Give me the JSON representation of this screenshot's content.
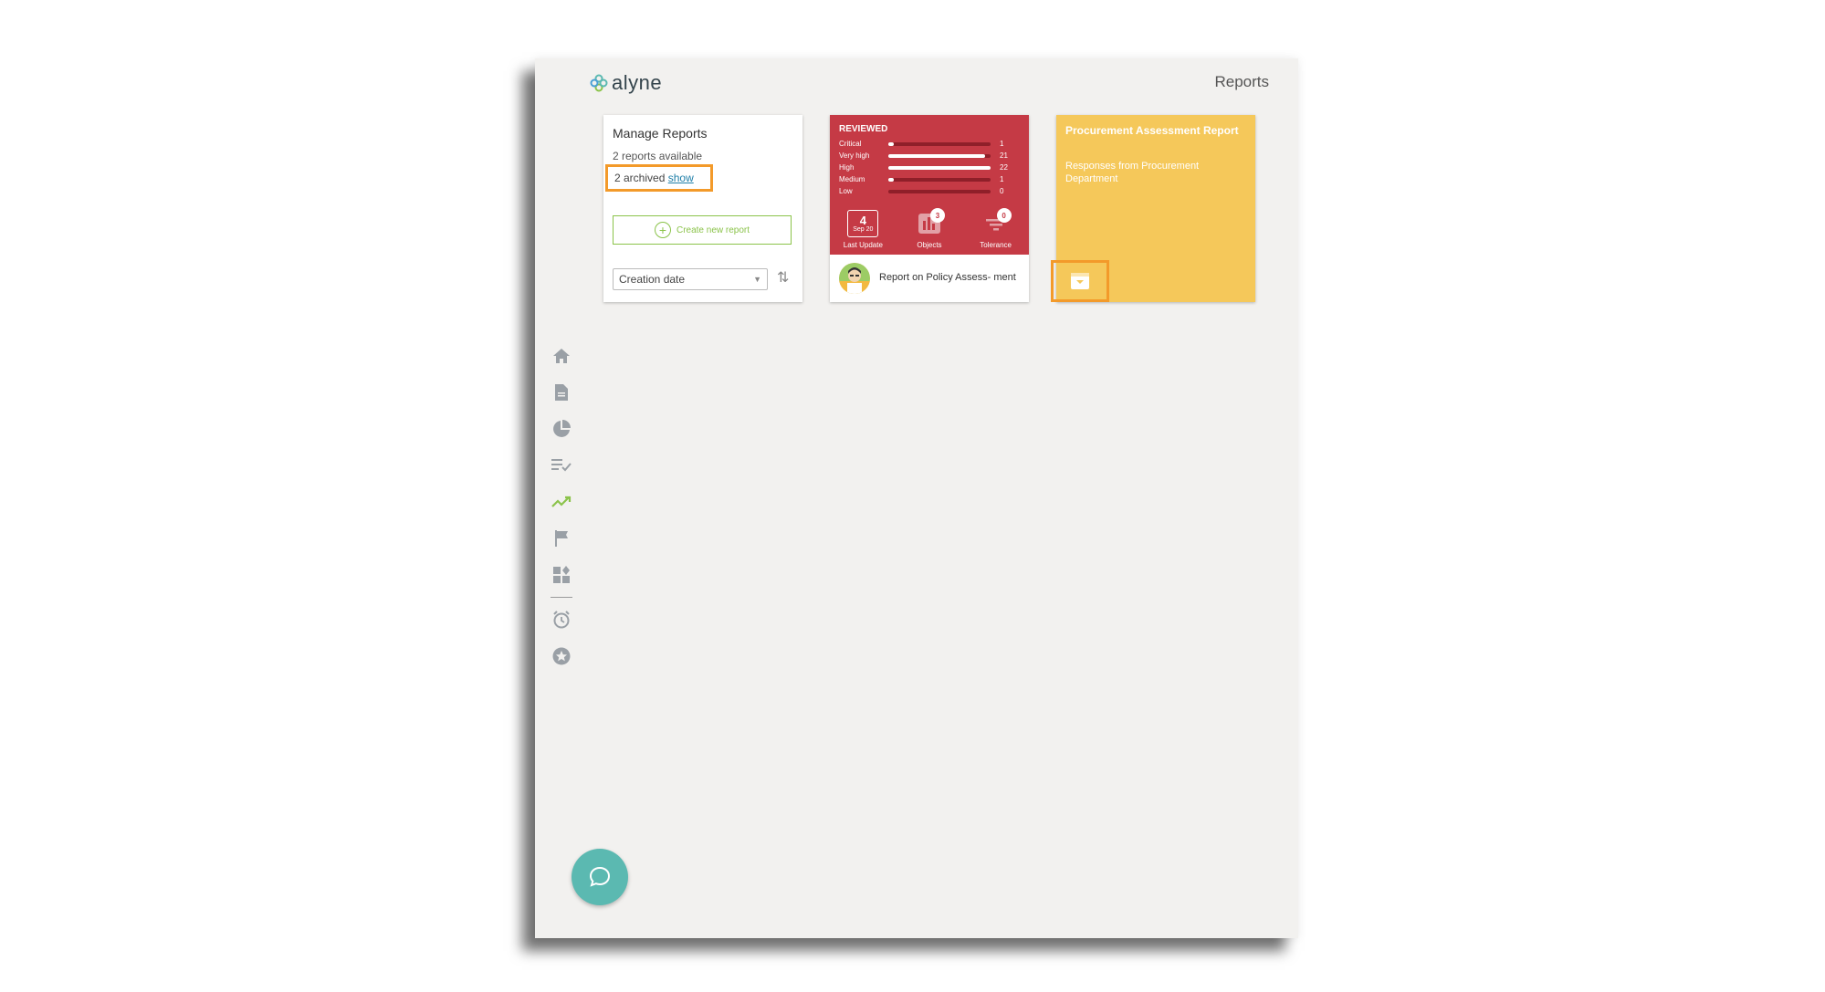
{
  "app": {
    "logo_text": "alyne",
    "page_title": "Reports"
  },
  "manage_card": {
    "title": "Manage Reports",
    "count_text": "2 reports available",
    "archived_text": "2 archived",
    "archived_link": "show",
    "create_label": "Create new report",
    "sort_value": "Creation date"
  },
  "report_card": {
    "status": "REVIEWED",
    "risks": [
      {
        "label": "Critical",
        "value": "1",
        "fill": 0.05
      },
      {
        "label": "Very high",
        "value": "21",
        "fill": 0.95
      },
      {
        "label": "High",
        "value": "22",
        "fill": 1.0
      },
      {
        "label": "Medium",
        "value": "1",
        "fill": 0.05
      },
      {
        "label": "Low",
        "value": "0",
        "fill": 0.0
      }
    ],
    "last_update_day": "4",
    "last_update_month": "Sep 20",
    "last_update_label": "Last Update",
    "objects_badge": "3",
    "objects_label": "Objects",
    "tolerance_badge": "0",
    "tolerance_label": "Tolerance",
    "title": "Report on Policy Assess- ment"
  },
  "procurement_card": {
    "title": "Procurement Assessment Report",
    "description": "Responses from Procurement Department"
  },
  "sidebar": {
    "icons": [
      "home-icon",
      "document-icon",
      "pie-chart-icon",
      "checklist-icon",
      "trend-icon",
      "flag-icon",
      "widgets-icon",
      "alarm-icon",
      "star-icon"
    ],
    "active": "trend-icon"
  },
  "colors": {
    "red_card": "#c53a45",
    "yellow_card": "#f5c85a",
    "highlight": "#f39a2a",
    "accent_green": "#8bc34a",
    "chat": "#5bb9b1"
  }
}
